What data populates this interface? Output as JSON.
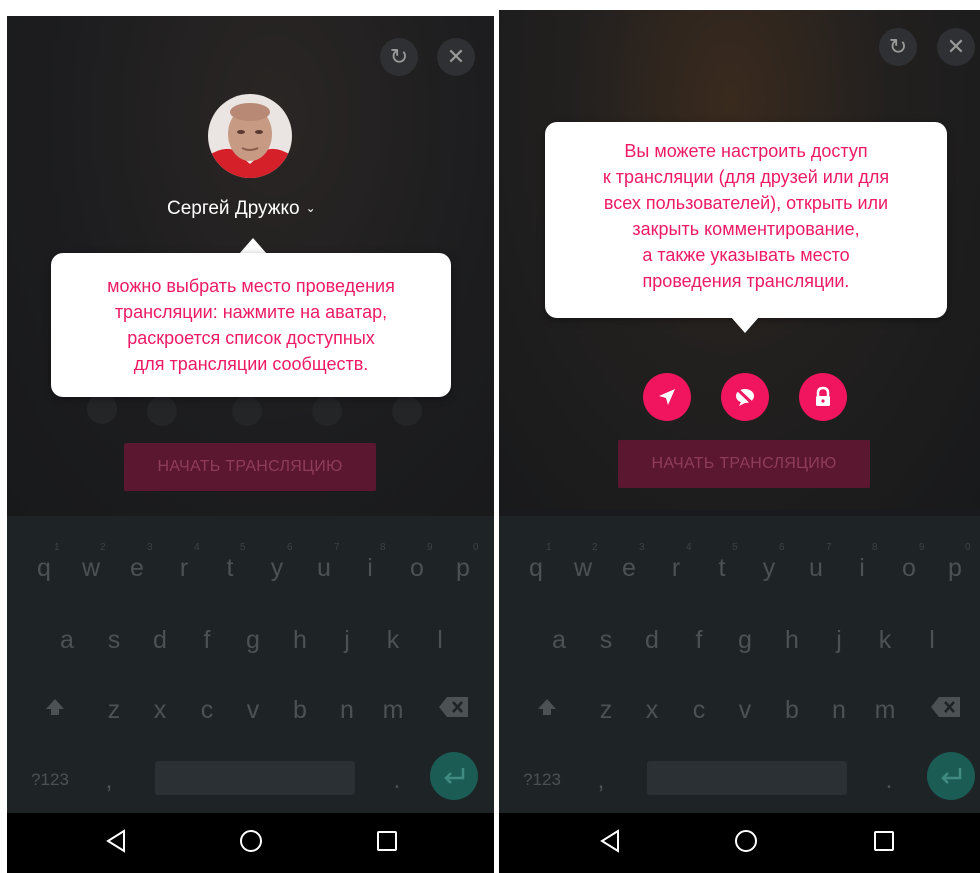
{
  "colors": {
    "accent": "#f0155e",
    "tooltip_text": "#ee1a63",
    "keyboard_bg": "#1e2326"
  },
  "left_screen": {
    "refresh_icon": "↻",
    "close_icon": "✕",
    "user_name": "Сергей Дружко",
    "tooltip_lines": [
      "можно выбрать место проведения",
      "трансляции: нажмите на аватар,",
      "раскроется список доступных",
      "для трансляции сообществ."
    ],
    "start_button": "НАЧАТЬ ТРАНСЛЯЦИЮ"
  },
  "right_screen": {
    "refresh_icon": "↻",
    "close_icon": "✕",
    "tooltip_lines": [
      "Вы можете настроить доступ",
      "к трансляции (для друзей или для",
      "всех пользователей), открыть или",
      "закрыть комментирование,",
      "а также указывать место",
      "проведения трансляции."
    ],
    "option_icons": [
      "location-arrow-icon",
      "comments-off-icon",
      "lock-icon"
    ],
    "start_button": "НАЧАТЬ ТРАНСЛЯЦИЮ"
  },
  "keyboard": {
    "row1": [
      "q",
      "w",
      "e",
      "r",
      "t",
      "y",
      "u",
      "i",
      "o",
      "p"
    ],
    "row1_hints": [
      "1",
      "2",
      "3",
      "4",
      "5",
      "6",
      "7",
      "8",
      "9",
      "0"
    ],
    "row2": [
      "a",
      "s",
      "d",
      "f",
      "g",
      "h",
      "j",
      "k",
      "l"
    ],
    "row3": [
      "z",
      "x",
      "c",
      "v",
      "b",
      "n",
      "m"
    ],
    "symbols_key": "?123",
    "comma": ",",
    "period": "."
  },
  "navbar": {
    "back": "◁",
    "home": "○",
    "recents": "□"
  }
}
